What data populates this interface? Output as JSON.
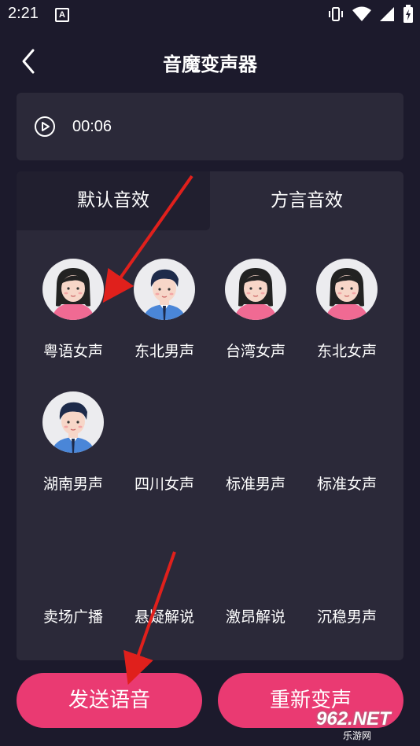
{
  "status": {
    "time": "2:21",
    "notif_icon": "A"
  },
  "header": {
    "title": "音魔变声器",
    "back_icon": "chevron-left-icon"
  },
  "player": {
    "time": "00:06",
    "icon": "play-circle-icon"
  },
  "tabs": [
    {
      "label": "默认音效",
      "selected": true
    },
    {
      "label": "方言音效",
      "selected": false
    }
  ],
  "effects": [
    {
      "label": "粤语女声",
      "avatar": "female"
    },
    {
      "label": "东北男声",
      "avatar": "male"
    },
    {
      "label": "台湾女声",
      "avatar": "female"
    },
    {
      "label": "东北女声",
      "avatar": "female"
    },
    {
      "label": "湖南男声",
      "avatar": "male"
    },
    {
      "label": "四川女声",
      "avatar": ""
    },
    {
      "label": "标准男声",
      "avatar": ""
    },
    {
      "label": "标准女声",
      "avatar": ""
    },
    {
      "label": "卖场广播",
      "avatar": ""
    },
    {
      "label": "悬疑解说",
      "avatar": ""
    },
    {
      "label": "激昂解说",
      "avatar": ""
    },
    {
      "label": "沉稳男声",
      "avatar": ""
    }
  ],
  "buttons": {
    "send": "发送语音",
    "redo": "重新变声"
  },
  "watermark": {
    "main": "962.NET",
    "sub": "乐游网"
  },
  "colors": {
    "background": "#1c1a2c",
    "panel": "#2b2939",
    "accent": "#ea3a72",
    "arrow": "#e0201c"
  }
}
